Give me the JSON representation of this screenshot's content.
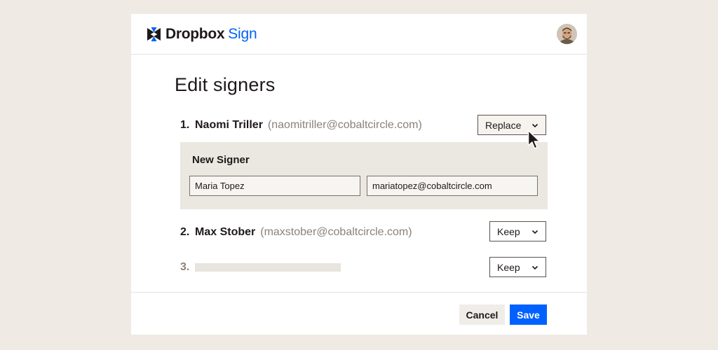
{
  "brand": {
    "name": "Dropbox",
    "product": "Sign",
    "accent_color": "#0061fe"
  },
  "page": {
    "title": "Edit signers"
  },
  "signers": [
    {
      "number": "1.",
      "name": "Naomi Triller",
      "email": "(naomitriller@cobaltcircle.com)",
      "action": "Replace"
    },
    {
      "number": "2.",
      "name": "Max Stober",
      "email": "(maxstober@cobaltcircle.com)",
      "action": "Keep"
    },
    {
      "number": "3.",
      "action": "Keep"
    }
  ],
  "new_signer": {
    "title": "New Signer",
    "name_value": "Maria Topez",
    "email_value": "mariatopez@cobaltcircle.com"
  },
  "footer": {
    "cancel_label": "Cancel",
    "save_label": "Save"
  },
  "icons": {
    "logo": "dropbox-logo-icon",
    "avatar": "user-avatar",
    "dropdown": "chevron-down-icon",
    "cursor": "mouse-pointer-icon"
  }
}
